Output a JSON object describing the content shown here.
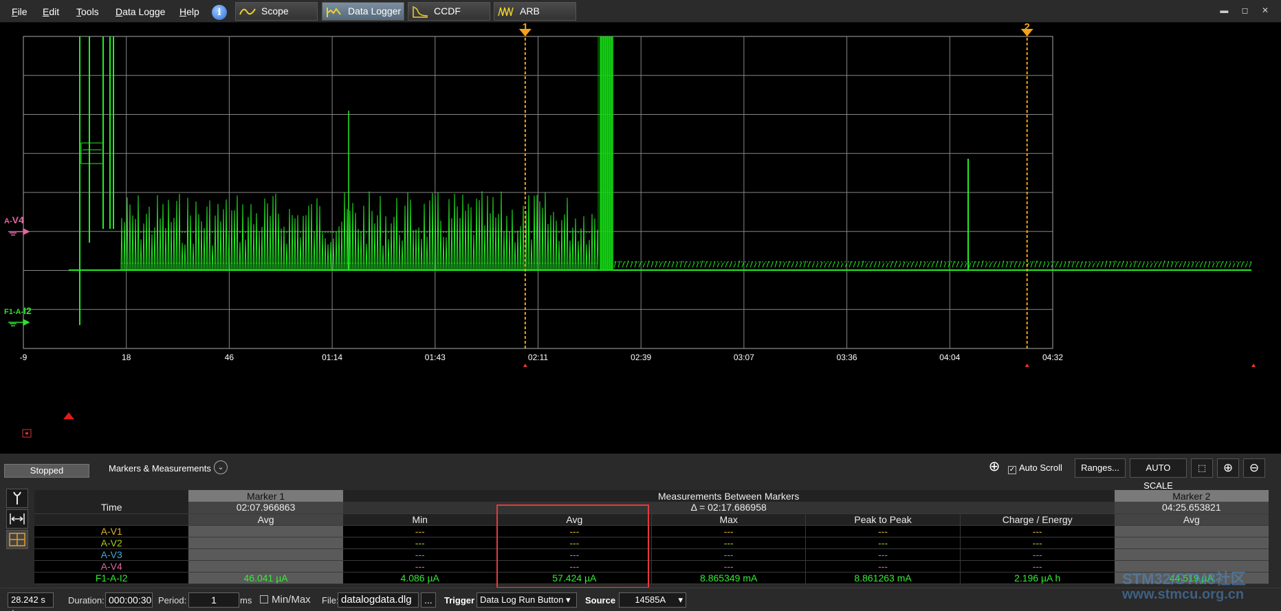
{
  "menu": [
    "File",
    "Edit",
    "Tools",
    "Data Logge",
    "Help"
  ],
  "tabs": [
    {
      "label": "Scope",
      "active": false
    },
    {
      "label": "Data Logger",
      "active": true
    },
    {
      "label": "CCDF",
      "active": false
    },
    {
      "label": "ARB",
      "active": false
    }
  ],
  "window_controls": "▬ ◻ ✕",
  "chart": {
    "channels": [
      {
        "prefix": "A-",
        "name": "V4",
        "color": "#e066a0"
      },
      {
        "prefix": "F1-A-",
        "name": "I2",
        "color": "#33dd33"
      }
    ],
    "x_ticks": [
      "-9",
      "18",
      "46",
      "01:14",
      "01:43",
      "02:11",
      "02:39",
      "03:07",
      "03:36",
      "04:04",
      "04:32"
    ],
    "markers": [
      {
        "label": "1",
        "time_s": 128
      },
      {
        "label": "2",
        "time_s": 265
      }
    ],
    "x_range_s": [
      -9,
      272
    ],
    "trace_color": "#22ee22",
    "marker_color": "#f6a21a"
  },
  "nav": {
    "first": "<<",
    "prev": "<",
    "next": ">",
    "last": ">>"
  },
  "panel": {
    "status": "Stopped",
    "title": "Markers & Measurements",
    "autoscroll_label": "Auto Scroll",
    "ranges_btn": "Ranges...",
    "autoscale_btn": "AUTO SCALE"
  },
  "table": {
    "marker1": {
      "title": "Marker 1",
      "time": "02:07.966863",
      "avg_header": "Avg"
    },
    "between": {
      "title": "Measurements Between Markers",
      "delta": "Δ = 02:17.686958",
      "headers": [
        "Min",
        "Avg",
        "Max",
        "Peak to Peak",
        "Charge / Energy"
      ]
    },
    "marker2": {
      "title": "Marker 2",
      "time": "04:25.653821",
      "avg_header": "Avg"
    },
    "time_label": "Time",
    "rows": [
      {
        "name": "A-V1",
        "color": "#e0b030",
        "m1": "",
        "vals": [
          "---",
          "---",
          "---",
          "---",
          "---"
        ],
        "m2": ""
      },
      {
        "name": "A-V2",
        "color": "#a8cc20",
        "m1": "",
        "vals": [
          "---",
          "---",
          "---",
          "---",
          "---"
        ],
        "m2": ""
      },
      {
        "name": "A-V3",
        "color": "#3aaee0",
        "m1": "",
        "vals": [
          "---",
          "---",
          "---",
          "---",
          "---"
        ],
        "m2": ""
      },
      {
        "name": "A-V4",
        "color": "#e066a0",
        "m1": "",
        "vals": [
          "---",
          "---",
          "---",
          "---",
          "---"
        ],
        "m2": ""
      },
      {
        "name": "F1-A-I2",
        "color": "#33ee33",
        "m1": "46.041 µA",
        "vals": [
          "4.086 µA",
          "57.424 µA",
          "8.865349 mA",
          "8.861263 mA",
          "2.196 µA h"
        ],
        "m2": "44.519 µA"
      }
    ]
  },
  "footer": {
    "timescale": "28.242 s /",
    "duration_label": "Duration:",
    "duration": "000:00:30",
    "period_label": "Period:",
    "period": "1",
    "period_unit": "ms",
    "minmax_label": "Min/Max",
    "file_label": "File:",
    "file": "datalogdata.dlg",
    "browse": "...",
    "trigger_label": "Trigger",
    "trigger": "Data Log Run Button",
    "source_label": "Source",
    "source": "14585A"
  },
  "watermark": [
    "STM32/STM8社区",
    "www.stmcu.org.cn"
  ]
}
